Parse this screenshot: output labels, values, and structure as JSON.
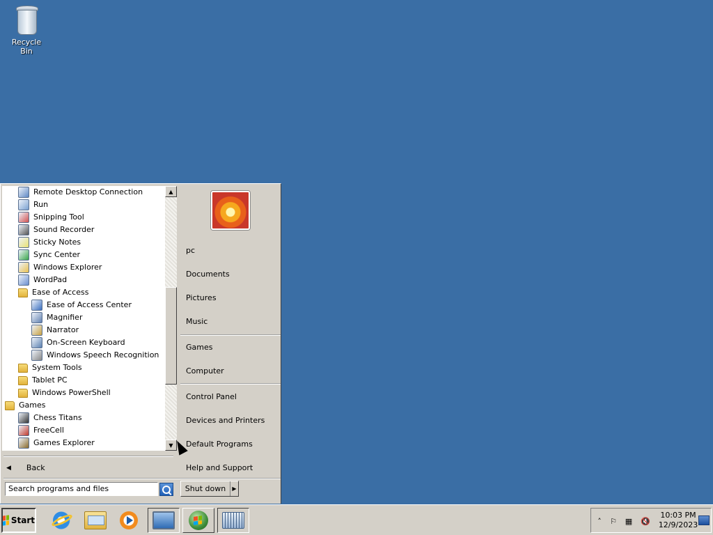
{
  "desktop": {
    "icons": [
      {
        "label": "Recycle Bin",
        "icon": "recycle-bin-icon"
      }
    ],
    "background": "#3a6ea5"
  },
  "start_menu": {
    "programs": [
      {
        "label": "Remote Desktop Connection",
        "icon": "remote-desktop-icon",
        "indent": 1
      },
      {
        "label": "Run",
        "icon": "run-icon",
        "indent": 1
      },
      {
        "label": "Snipping Tool",
        "icon": "snipping-tool-icon",
        "indent": 1
      },
      {
        "label": "Sound Recorder",
        "icon": "microphone-icon",
        "indent": 1
      },
      {
        "label": "Sticky Notes",
        "icon": "sticky-notes-icon",
        "indent": 1
      },
      {
        "label": "Sync Center",
        "icon": "sync-center-icon",
        "indent": 1
      },
      {
        "label": "Windows Explorer",
        "icon": "explorer-icon",
        "indent": 1
      },
      {
        "label": "WordPad",
        "icon": "wordpad-icon",
        "indent": 1
      },
      {
        "label": "Ease of Access",
        "icon": "folder-icon",
        "indent": 1
      },
      {
        "label": "Ease of Access Center",
        "icon": "ease-of-access-icon",
        "indent": 2
      },
      {
        "label": "Magnifier",
        "icon": "magnifier-icon",
        "indent": 2
      },
      {
        "label": "Narrator",
        "icon": "narrator-icon",
        "indent": 2
      },
      {
        "label": "On-Screen Keyboard",
        "icon": "keyboard-icon",
        "indent": 2
      },
      {
        "label": "Windows Speech Recognition",
        "icon": "speech-recognition-icon",
        "indent": 2
      },
      {
        "label": "System Tools",
        "icon": "folder-icon",
        "indent": 1
      },
      {
        "label": "Tablet PC",
        "icon": "folder-icon",
        "indent": 1
      },
      {
        "label": "Windows PowerShell",
        "icon": "folder-icon",
        "indent": 1
      },
      {
        "label": "Games",
        "icon": "folder-icon",
        "indent": 0
      },
      {
        "label": "Chess Titans",
        "icon": "chess-icon",
        "indent": 1
      },
      {
        "label": "FreeCell",
        "icon": "freecell-icon",
        "indent": 1
      },
      {
        "label": "Games Explorer",
        "icon": "games-explorer-icon",
        "indent": 1
      }
    ],
    "back_label": "Back",
    "search_placeholder": "Search programs and files",
    "user_name": "pc",
    "right_items": [
      {
        "label": "Documents"
      },
      {
        "label": "Pictures"
      },
      {
        "label": "Music"
      },
      {
        "label": "Games"
      },
      {
        "label": "Computer"
      },
      {
        "label": "Control Panel"
      },
      {
        "label": "Devices and Printers"
      },
      {
        "label": "Default Programs"
      },
      {
        "label": "Help and Support"
      }
    ],
    "shutdown_label": "Shut down"
  },
  "taskbar": {
    "start_label": "Start",
    "pinned": [
      {
        "name": "internet-explorer-icon"
      },
      {
        "name": "windows-explorer-icon"
      },
      {
        "name": "media-player-icon"
      },
      {
        "name": "remote-desktop-icon"
      },
      {
        "name": "windows-orb-icon"
      },
      {
        "name": "on-screen-keyboard-icon"
      }
    ],
    "clock_time": "10:03 PM",
    "clock_date": "12/9/2023"
  }
}
